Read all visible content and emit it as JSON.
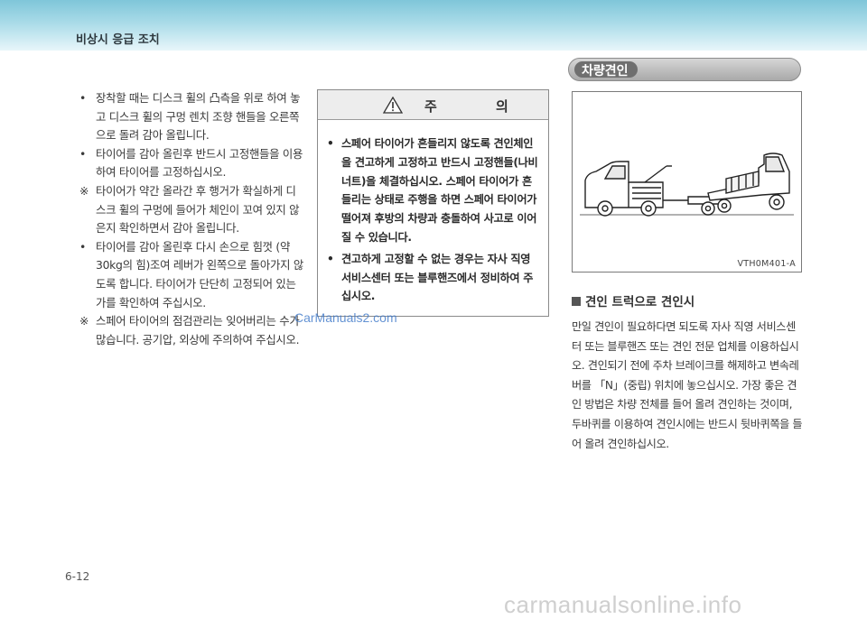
{
  "header": {
    "section_title": "비상시 응급 조치"
  },
  "left_column": {
    "items": [
      {
        "mark": "•",
        "text": "장착할 때는 디스크 휠의 凸측을 위로 하여 놓고 디스크 휠의 구멍 렌치 조향 핸들을 오른쪽으로 돌려 감아 올립니다."
      },
      {
        "mark": "•",
        "text": "타이어를 감아 올린후 반드시 고정핸들을 이용하여 타이어를 고정하십시오."
      },
      {
        "mark": "※",
        "text": "타이어가 약간 올라간 후 행거가 확실하게 디스크 휠의 구멍에 들어가 체인이 꼬여 있지 않은지 확인하면서 감아 올립니다."
      },
      {
        "mark": "•",
        "text": "타이어를 감아 올린후 다시 손으로 힘껏 (약 30kg의 힘)조여 레버가 왼쪽으로 돌아가지 않도록 합니다. 타이어가 단단히 고정되어 있는가를 확인하여 주십시오."
      },
      {
        "mark": "※",
        "text": "스페어 타이어의 점검관리는 잊어버리는 수가 많습니다. 공기압, 외상에 주의하여 주십시오."
      }
    ]
  },
  "caution": {
    "title": "주 의",
    "items": [
      {
        "mark": "•",
        "text": "스페어 타이어가 흔들리지 않도록 견인체인을 견고하게 고정하고 반드시 고정핸들(나비너트)을 체결하십시오. 스페어 타이어가 흔들리는 상태로 주행을 하면 스페어 타이어가 떨어져 후방의 차량과 충돌하여 사고로 이어질 수 있습니다."
      },
      {
        "mark": "•",
        "text": "견고하게 고정할 수 없는 경우는 자사 직영 서비스센터 또는 블루핸즈에서 정비하여 주십시오."
      }
    ]
  },
  "right_column": {
    "section_pill": "차량견인",
    "figure_code": "VTH0M401-A",
    "subheading": "견인 트럭으로 견인시",
    "paragraph": "만일 견인이 필요하다면 되도록 자사 직영 서비스센터 또는 블루핸즈 또는 견인 전문 업체를 이용하십시오. 견인되기 전에 주차 브레이크를 해제하고 변속레버를 「N」(중립) 위치에 놓으십시오. 가장 좋은 견인 방법은 차량 전체를 들어 올려 견인하는 것이며, 두바퀴를 이용하여 견인시에는 반드시 뒷바퀴쪽을 들어 올려 견인하십시오."
  },
  "footer": {
    "page_number": "6-12"
  },
  "watermarks": {
    "overlay": "CarManuals2.com",
    "footer": "carmanualsonline.info"
  },
  "colors": {
    "header_band": "#a9dbe8",
    "pill": "#a9a9a9",
    "watermark_blue": "#3d78c9"
  }
}
